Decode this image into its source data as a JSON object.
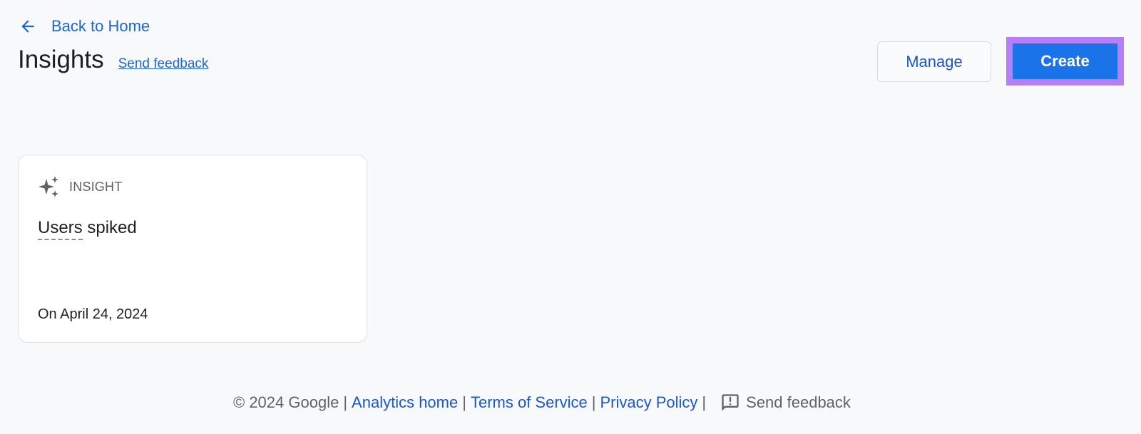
{
  "header": {
    "back_label": "Back to Home",
    "title": "Insights",
    "feedback_label": "Send feedback"
  },
  "actions": {
    "manage_label": "Manage",
    "create_label": "Create"
  },
  "cards": [
    {
      "type_label": "INSIGHT",
      "icon": "sparkle-icon",
      "title_prefix": "Users",
      "title_suffix": " spiked",
      "date": "On April 24, 2024"
    }
  ],
  "footer": {
    "copyright": "© 2024 Google",
    "links": [
      "Analytics home",
      "Terms of Service",
      "Privacy Policy"
    ],
    "separator": "|",
    "feedback_label": "Send feedback"
  },
  "colors": {
    "accent": "#1a73e8",
    "link": "#1a66d2",
    "focus_highlight": "#b77ff7"
  }
}
